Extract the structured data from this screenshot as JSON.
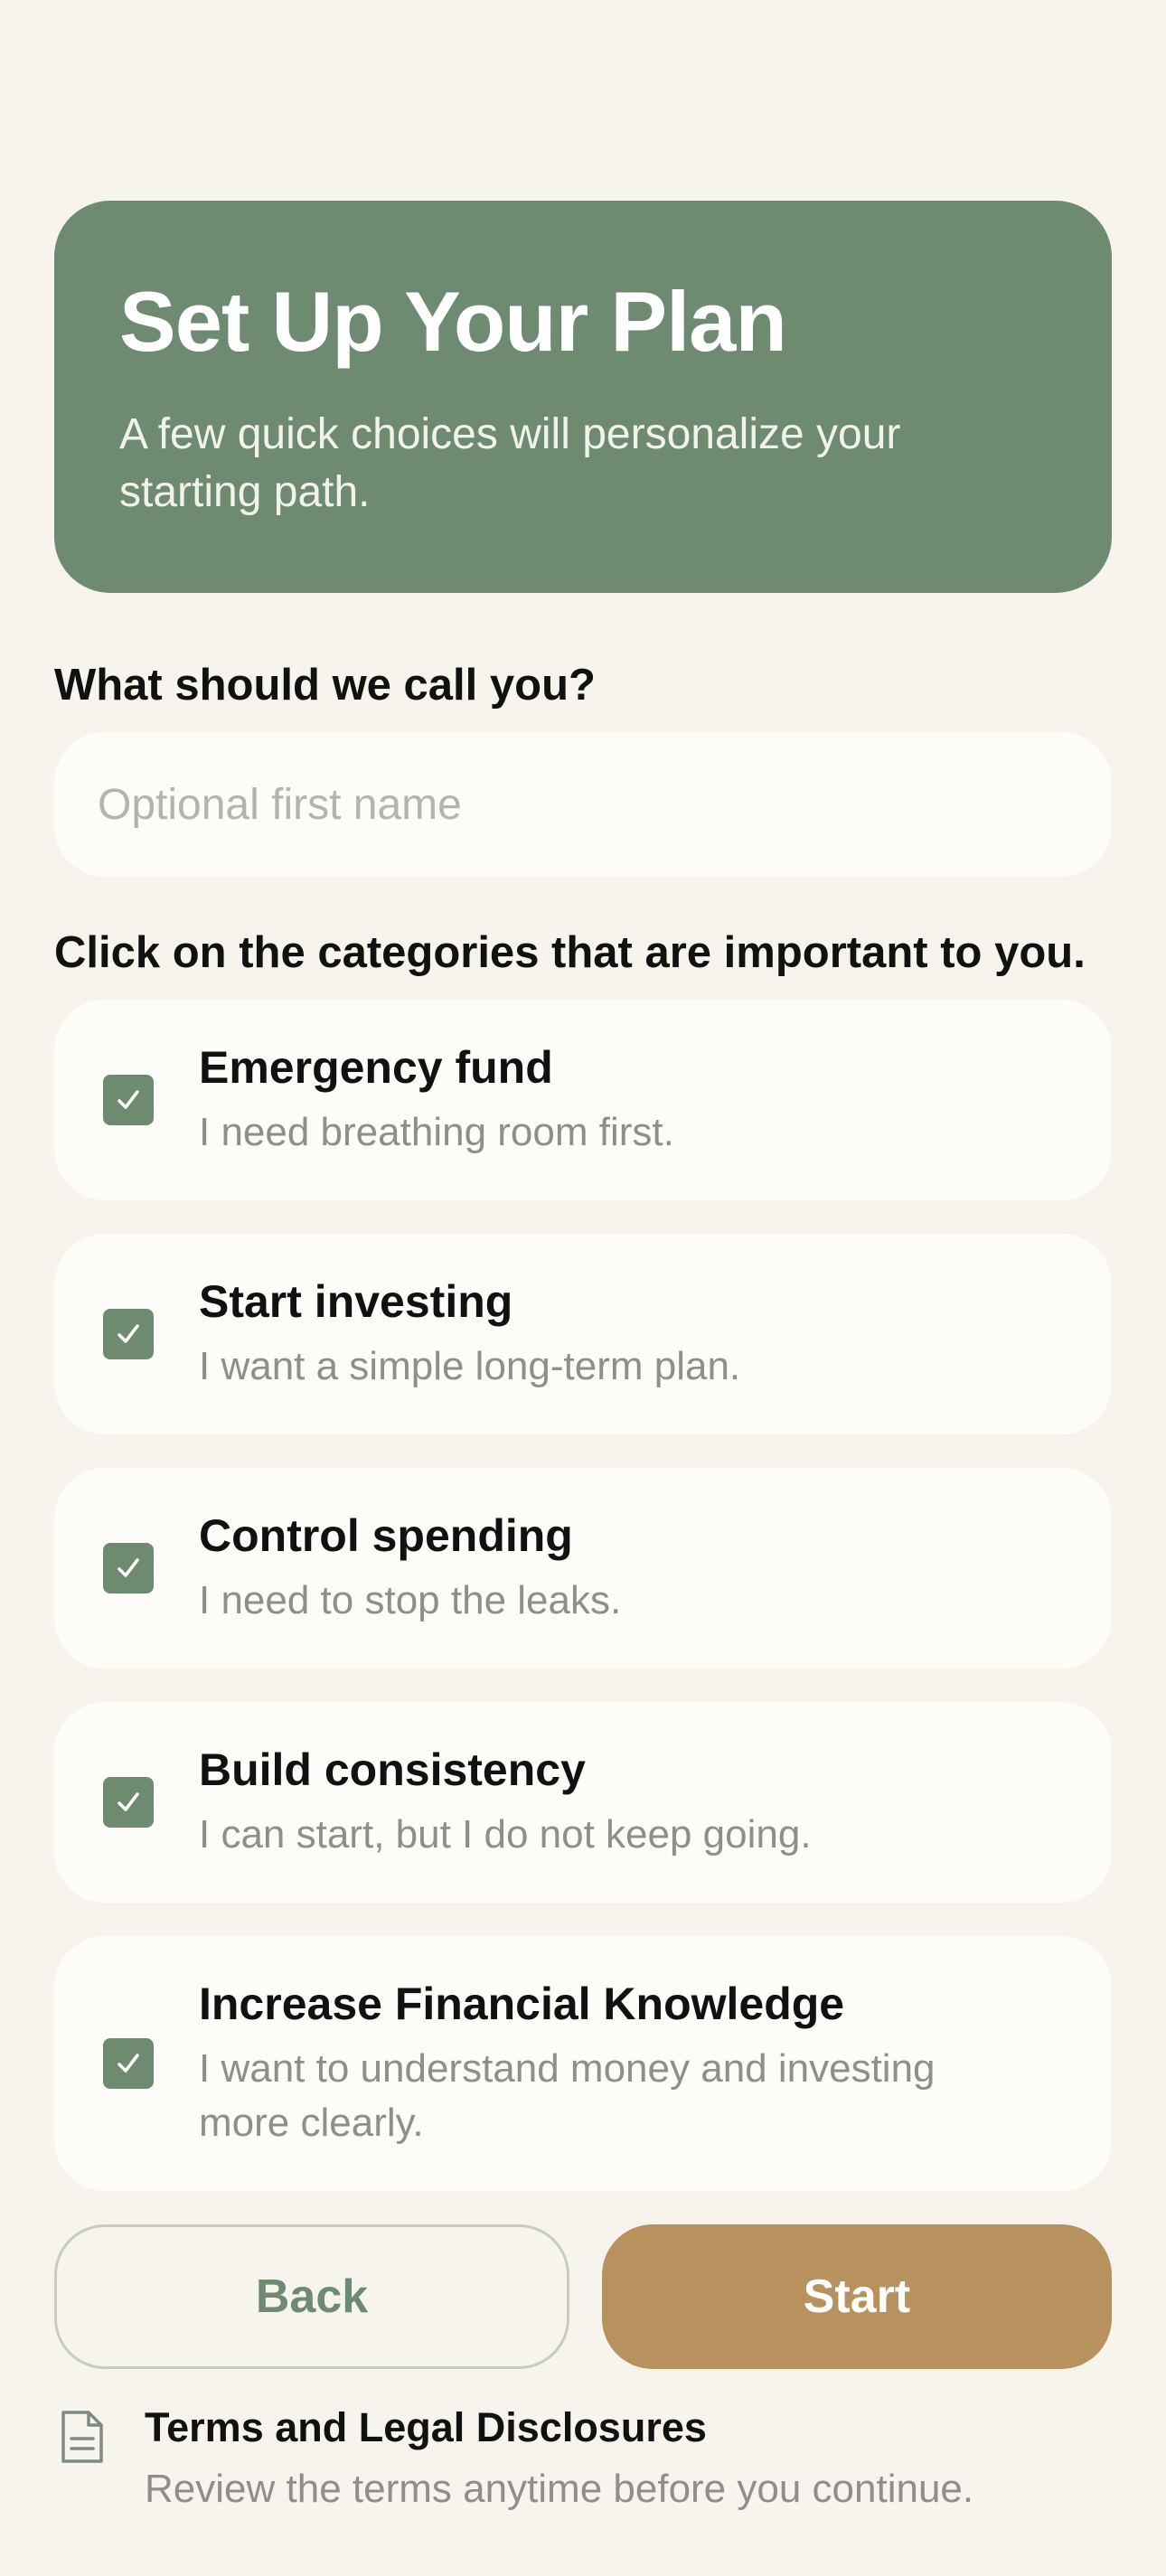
{
  "hero": {
    "title": "Set Up Your Plan",
    "subtitle": "A few quick choices will personalize your starting path."
  },
  "name_section": {
    "label": "What should we call you?",
    "placeholder": "Optional first name",
    "value": ""
  },
  "categories_section": {
    "label": "Click on the categories that are important to you.",
    "items": [
      {
        "title": "Emergency fund",
        "description": "I need breathing room first.",
        "checked": true
      },
      {
        "title": "Start investing",
        "description": "I want a simple long-term plan.",
        "checked": true
      },
      {
        "title": "Control spending",
        "description": "I need to stop the leaks.",
        "checked": true
      },
      {
        "title": "Build consistency",
        "description": "I can start, but I do not keep going.",
        "checked": true
      },
      {
        "title": "Increase Financial Knowledge",
        "description": "I want to understand money and investing more clearly.",
        "checked": true
      }
    ]
  },
  "actions": {
    "back_label": "Back",
    "start_label": "Start"
  },
  "terms": {
    "title": "Terms and Legal Disclosures",
    "description": "Review the terms anytime before you continue.",
    "icon": "document-icon"
  },
  "colors": {
    "background": "#F7F4EE",
    "hero": "#6E8B72",
    "card": "#FDFCF8",
    "checkbox": "#6E8B72",
    "start_button": "#B8925E",
    "back_text": "#6E8B72",
    "muted_text": "#8F8E8A"
  }
}
